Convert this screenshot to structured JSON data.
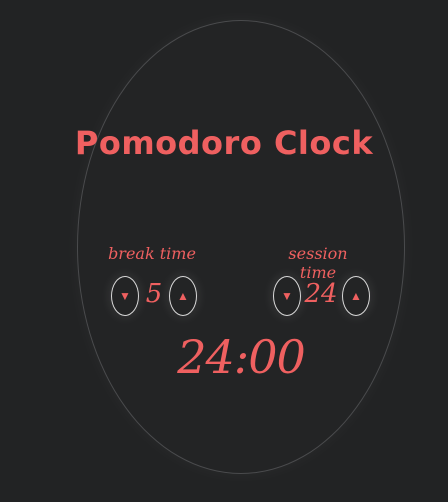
{
  "app": {
    "title": "Pomodoro Clock"
  },
  "break": {
    "label": "break time",
    "value": "5",
    "decrement_icon": "triangle-down-icon",
    "increment_icon": "triangle-up-icon"
  },
  "session": {
    "label": "session time",
    "value": "24",
    "decrement_icon": "triangle-down-icon",
    "increment_icon": "triangle-up-icon"
  },
  "timer": {
    "display": "24:00"
  },
  "colors": {
    "accent": "#ef6060",
    "background": "#222324",
    "button_border": "#d9d9d9"
  }
}
